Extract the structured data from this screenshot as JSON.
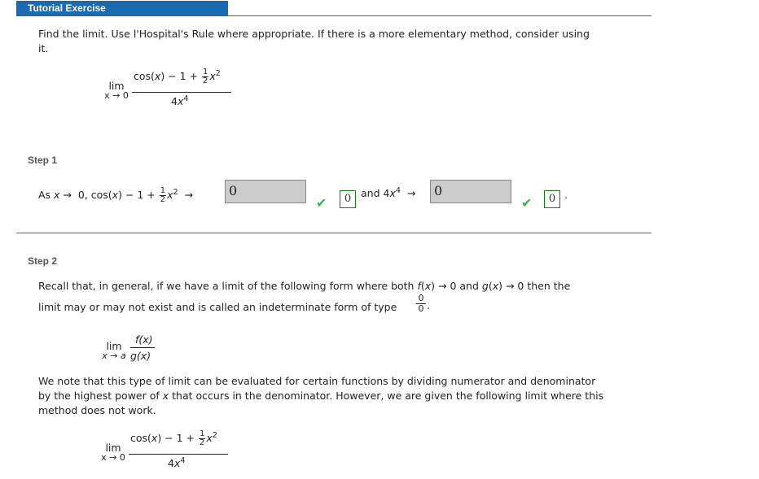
{
  "header": {
    "title": "Tutorial Exercise"
  },
  "prompt": {
    "line1": "Find the limit. Use l'Hospital's Rule where appropriate. If there is a more elementary method, consider using",
    "line2": "it."
  },
  "limit_expr": {
    "lim": "lim",
    "sub": "x → 0",
    "num_a": "cos(",
    "num_x": "x",
    "num_b": ") − 1 + ",
    "half_n": "1",
    "half_d": "2",
    "num_x2": "x",
    "num_exp": "2",
    "den_a": "4",
    "den_x": "x",
    "den_exp": "4"
  },
  "step1": {
    "label": "Step 1",
    "text_as": "As ",
    "text_x": "x",
    "text_arrow": " → ",
    "text_zero_cos": "0, cos(",
    "text_x2": "x",
    "text_rest": ") − 1 + ",
    "half_n": "1",
    "half_d": "2",
    "text_x3": "x",
    "exp2": "2",
    "arrow2": "→",
    "answer1_value": "0",
    "answer1_correct": "0",
    "and_text": "and 4",
    "and_x": "x",
    "exp4": "4",
    "arrow3": "→",
    "answer2_value": "0",
    "answer2_correct": "0",
    "period": "."
  },
  "step2": {
    "label": "Step 2",
    "para1_a": "Recall that, in general, if we have a limit of the following form where both ",
    "para1_f": "f",
    "para1_b": "(",
    "para1_x1": "x",
    "para1_c": ") → 0 and ",
    "para1_g": "g",
    "para1_d": "(",
    "para1_x2": "x",
    "para1_e": ") → 0 then the",
    "para2": "limit may or may not exist and is called an indeterminate form of type",
    "type_n": "0",
    "type_d": "0",
    "type_period": ".",
    "general_lim": {
      "lim": "lim",
      "sub_x": "x",
      "sub_arrow": " → ",
      "sub_a": "a",
      "num": "f(x)",
      "den": "g(x)"
    },
    "para3_line1": "We note that this type of limit can be evaluated for certain functions by dividing numerator and denominator",
    "para3_line2_a": "by the highest power of ",
    "para3_line2_x": "x",
    "para3_line2_b": " that occurs in the denominator. However, we are given the following limit where this",
    "para3_line3": "method does not work."
  },
  "colors": {
    "header": "#1a6aad",
    "check": "#3bb34a",
    "correct_border": "#1a7a1a",
    "answer_bg": "#cccccc"
  }
}
